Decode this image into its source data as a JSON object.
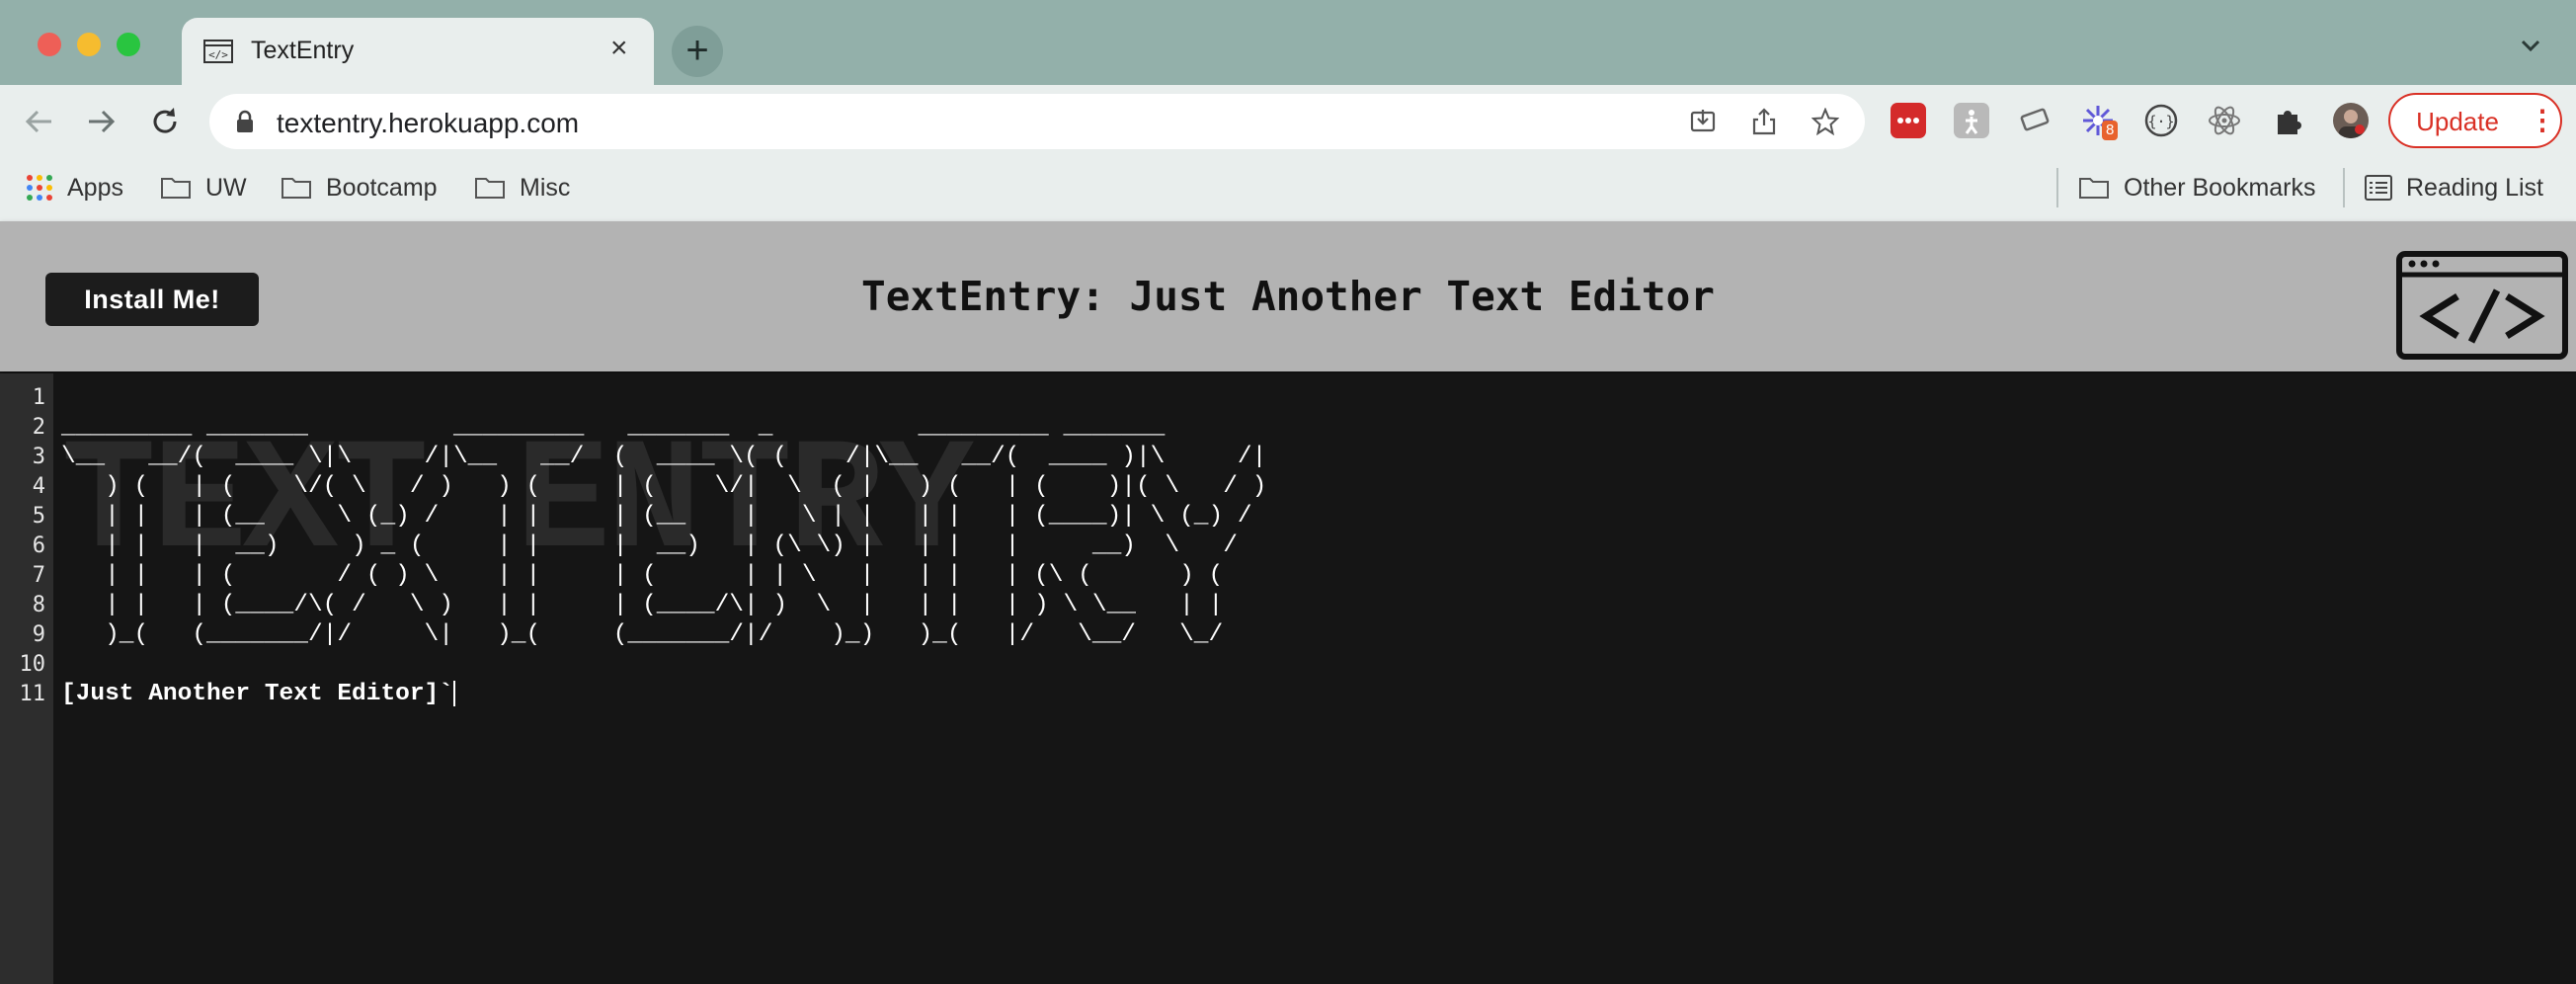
{
  "browser": {
    "tab": {
      "title": "TextEntry",
      "favicon": "code-icon",
      "close": "×"
    },
    "new_tab": "+",
    "url": "textentry.herokuapp.com",
    "update_label": "Update",
    "extension_badge": "8",
    "bookmarks": [
      {
        "label": "Apps",
        "icon": "apps-grid-icon"
      },
      {
        "label": "UW",
        "icon": "folder-icon"
      },
      {
        "label": "Bootcamp",
        "icon": "folder-icon"
      },
      {
        "label": "Misc",
        "icon": "folder-icon"
      }
    ],
    "other_bookmarks": "Other Bookmarks",
    "reading_list": "Reading List"
  },
  "app": {
    "install_label": "Install Me!",
    "title": "TextEntry: Just Another Text Editor",
    "logo": "code-brackets-icon"
  },
  "editor": {
    "line_numbers": [
      "1",
      "2",
      "3",
      "4",
      "5",
      "6",
      "7",
      "8",
      "9",
      "10",
      "11"
    ],
    "lines": [
      "",
      "_________ _______          _________   _______  _          _________ _______          ",
      "\\__   __/(  ____ \\|\\     /|\\__   __/  (  ____ \\( (    /|\\__   __/(  ____ )|\\     /|",
      "   ) (   | (    \\/( \\   / )   ) (     | (    \\/|  \\  ( |   ) (   | (    )|( \\   / )",
      "   | |   | (__     \\ (_) /    | |     | (__    |   \\ | |   | |   | (____)| \\ (_) / ",
      "   | |   |  __)     ) _ (     | |     |  __)   | (\\ \\) |   | |   |     __)  \\   /  ",
      "   | |   | (       / ( ) \\    | |     | (      | | \\   |   | |   | (\\ (      ) (   ",
      "   | |   | (____/\\( /   \\ )   | |     | (____/\\| )  \\  |   | |   | ) \\ \\__   | |   ",
      "   )_(   (_______/|/     \\|   )_(     (_______/|/    )_)   )_(   |/   \\__/   \\_/   ",
      "",
      "[Just Another Text Editor]`"
    ],
    "watermark": "TEXT ENTRY"
  },
  "colors": {
    "tabstrip": "#93b0aa",
    "toolbar": "#e9eeed",
    "header": "#b3b3b3",
    "editor_bg": "#151515",
    "gutter": "#2d2d2d",
    "update_red": "#d93025"
  }
}
